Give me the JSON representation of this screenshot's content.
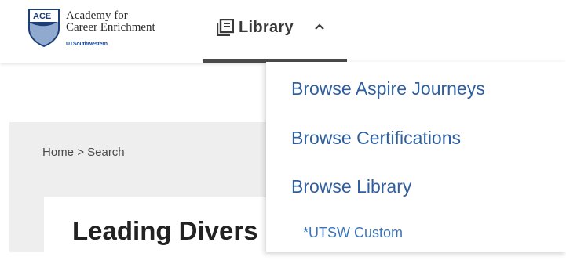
{
  "brand": {
    "logo_badge": "ACE",
    "name_line1": "Academy for",
    "name_line2": "Career Enrichment",
    "sub": "UTSouthwestern",
    "color": "#1a4a9e"
  },
  "nav": {
    "library_label": "Library",
    "library_icon": "book-icon",
    "expanded_icon": "chevron-up-icon"
  },
  "breadcrumb": {
    "home": "Home",
    "separator": ">",
    "current": "Search"
  },
  "page": {
    "title": "Leading Divers"
  },
  "dropdown": {
    "items": [
      {
        "label": "Browse Aspire Journeys"
      },
      {
        "label": "Browse Certifications"
      },
      {
        "label": "Browse Library"
      },
      {
        "label": "*UTSW Custom"
      }
    ],
    "link_color": "#2f5f9e"
  }
}
